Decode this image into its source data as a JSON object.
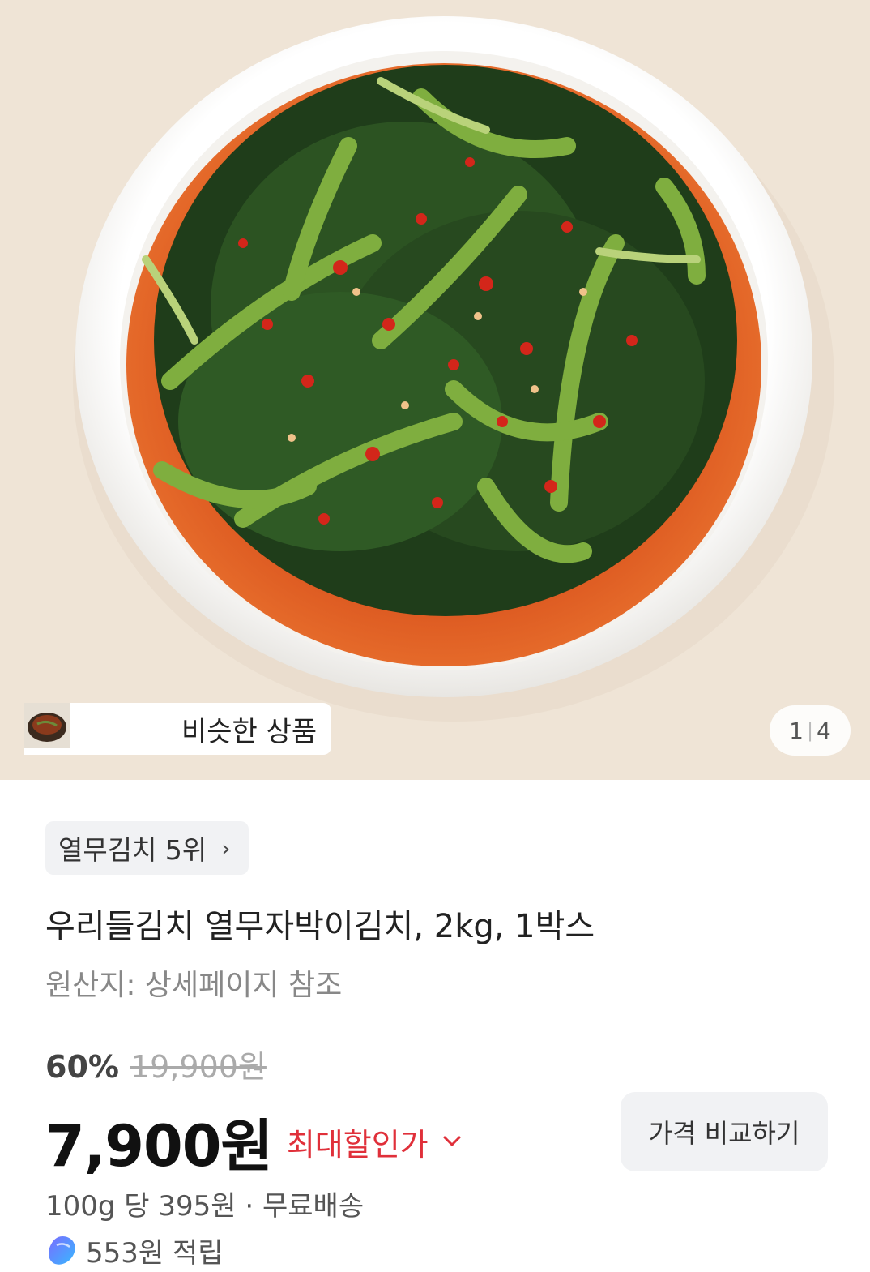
{
  "gallery": {
    "similar_label": "비슷한 상품",
    "page_current": "1",
    "page_total": "4"
  },
  "product": {
    "rank_badge": "열무김치 5위",
    "title": "우리들김치 열무자박이김치, 2kg, 1박스",
    "origin": "원산지: 상세페이지 참조"
  },
  "pricing": {
    "discount_percent": "60%",
    "original_price": "19,900원",
    "price": "7,900원",
    "max_discount_label": "최대할인가",
    "compare_button": "가격 비교하기",
    "unit_price": "100g 당 395원",
    "shipping": "무료배송",
    "separator": "·",
    "points": "553원 적립"
  },
  "colors": {
    "accent_red": "#e0303a",
    "points_icon_gradient": [
      "#7b6cff",
      "#37b8ff"
    ]
  },
  "icons": {
    "rank_chevron": "chevron-right-icon",
    "discount_chevron": "chevron-down-icon",
    "points": "cash-points-icon"
  }
}
